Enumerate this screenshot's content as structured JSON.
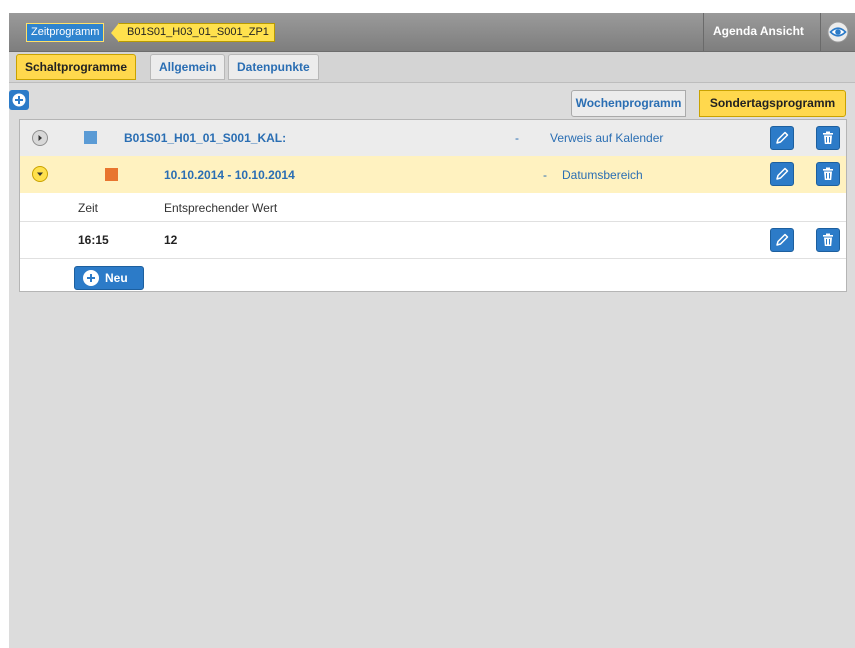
{
  "titlebar": {
    "crumb_root": "Zeitprogramm",
    "crumb_current": "B01S01_H03_01_S001_ZP1",
    "agenda_label": "Agenda Ansicht"
  },
  "tabs": [
    {
      "label": "Schaltprogramme",
      "active": true
    },
    {
      "label": "Allgemein",
      "active": false
    },
    {
      "label": "Datenpunkte",
      "active": false
    }
  ],
  "program_switch": {
    "week_label": "Wochenprogramm",
    "special_label": "Sondertagsprogramm",
    "selected": "Sondertagsprogramm"
  },
  "calendar_entry": {
    "name": "B01S01_H01_01_S001_KAL:",
    "separator": "-",
    "type": "Verweis auf Kalender",
    "color": "#5b9bd5"
  },
  "date_entry": {
    "range": "10.10.2014 - 10.10.2014",
    "separator": "-",
    "type": "Datumsbereich",
    "color": "#e8752f"
  },
  "value_table": {
    "headers": [
      "Zeit",
      "Entsprechender Wert"
    ],
    "rows": [
      {
        "time": "16:15",
        "value": "12"
      }
    ]
  },
  "new_button_label": "Neu",
  "colors": {
    "accent_blue": "#2c7bc8",
    "highlight_yellow": "#ffd84d"
  }
}
